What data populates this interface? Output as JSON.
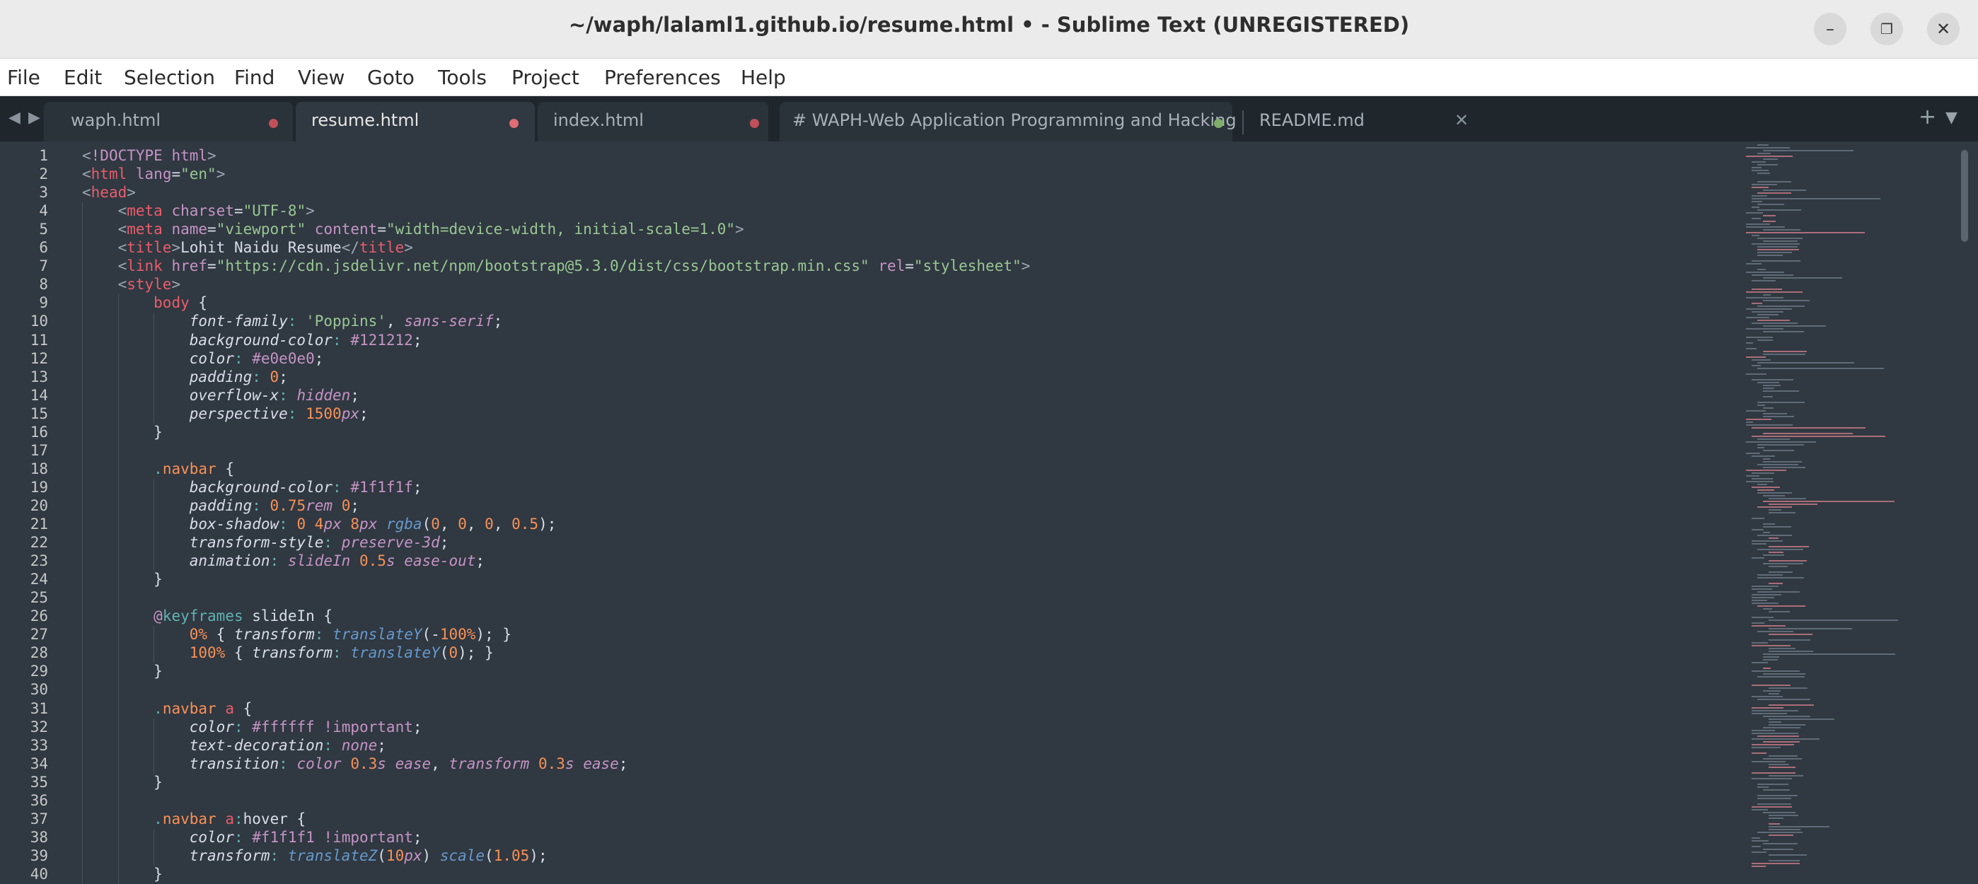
{
  "window": {
    "title": "~/waph/lalaml1.github.io/resume.html • - Sublime Text (UNREGISTERED)",
    "minimize_icon": "minimize-icon",
    "maximize_icon": "maximize-icon",
    "close_icon": "close-icon"
  },
  "menu": [
    "File",
    "Edit",
    "Selection",
    "Find",
    "View",
    "Goto",
    "Tools",
    "Project",
    "Preferences",
    "Help"
  ],
  "tabs": [
    {
      "label": "waph.html",
      "modified": true,
      "dot_color": "#c0505a"
    },
    {
      "label": "resume.html",
      "modified": true,
      "active": true,
      "dot_color": "#e06c75"
    },
    {
      "label": "index.html",
      "modified": true,
      "dot_color": "#c0505a"
    },
    {
      "label": "# WAPH-Web Application Programming and Hacking",
      "modified": true,
      "dot_color": "#7fae6a"
    },
    {
      "label": "README.md",
      "modified": false
    }
  ],
  "tab_controls": {
    "new_tab_icon": "plus-icon",
    "tab_menu_icon": "chevron-down-icon"
  },
  "line_numbers": [
    "1",
    "2",
    "3",
    "4",
    "5",
    "6",
    "7",
    "8",
    "9",
    "10",
    "11",
    "12",
    "13",
    "14",
    "15",
    "16",
    "17",
    "18",
    "19",
    "20",
    "21",
    "22",
    "23",
    "24",
    "25",
    "26",
    "27",
    "28",
    "29",
    "30",
    "31",
    "32",
    "33",
    "34",
    "35",
    "36",
    "37",
    "38",
    "39",
    "40"
  ],
  "code_lines": [
    "<!DOCTYPE html>",
    "<html lang=\"en\">",
    "<head>",
    "    <meta charset=\"UTF-8\">",
    "    <meta name=\"viewport\" content=\"width=device-width, initial-scale=1.0\">",
    "    <title>Lohit Naidu Resume</title>",
    "    <link href=\"https://cdn.jsdelivr.net/npm/bootstrap@5.3.0/dist/css/bootstrap.min.css\" rel=\"stylesheet\">",
    "    <style>",
    "        body {",
    "            font-family: 'Poppins', sans-serif;",
    "            background-color: #121212;",
    "            color: #e0e0e0;",
    "            padding: 0;",
    "            overflow-x: hidden;",
    "            perspective: 1500px;",
    "        }",
    "",
    "        .navbar {",
    "            background-color: #1f1f1f;",
    "            padding: 0.75rem 0;",
    "            box-shadow: 0 4px 8px rgba(0, 0, 0, 0.5);",
    "            transform-style: preserve-3d;",
    "            animation: slideIn 0.5s ease-out;",
    "        }",
    "",
    "        @keyframes slideIn {",
    "            0% { transform: translateY(-100%); }",
    "            100% { transform: translateY(0); }",
    "        }",
    "",
    "        .navbar a {",
    "            color: #ffffff !important;",
    "            text-decoration: none;",
    "            transition: color 0.3s ease, transform 0.3s ease;",
    "        }",
    "",
    "        .navbar a:hover {",
    "            color: #f1f1f1 !important;",
    "            transform: translateZ(10px) scale(1.05);",
    "        }"
  ]
}
